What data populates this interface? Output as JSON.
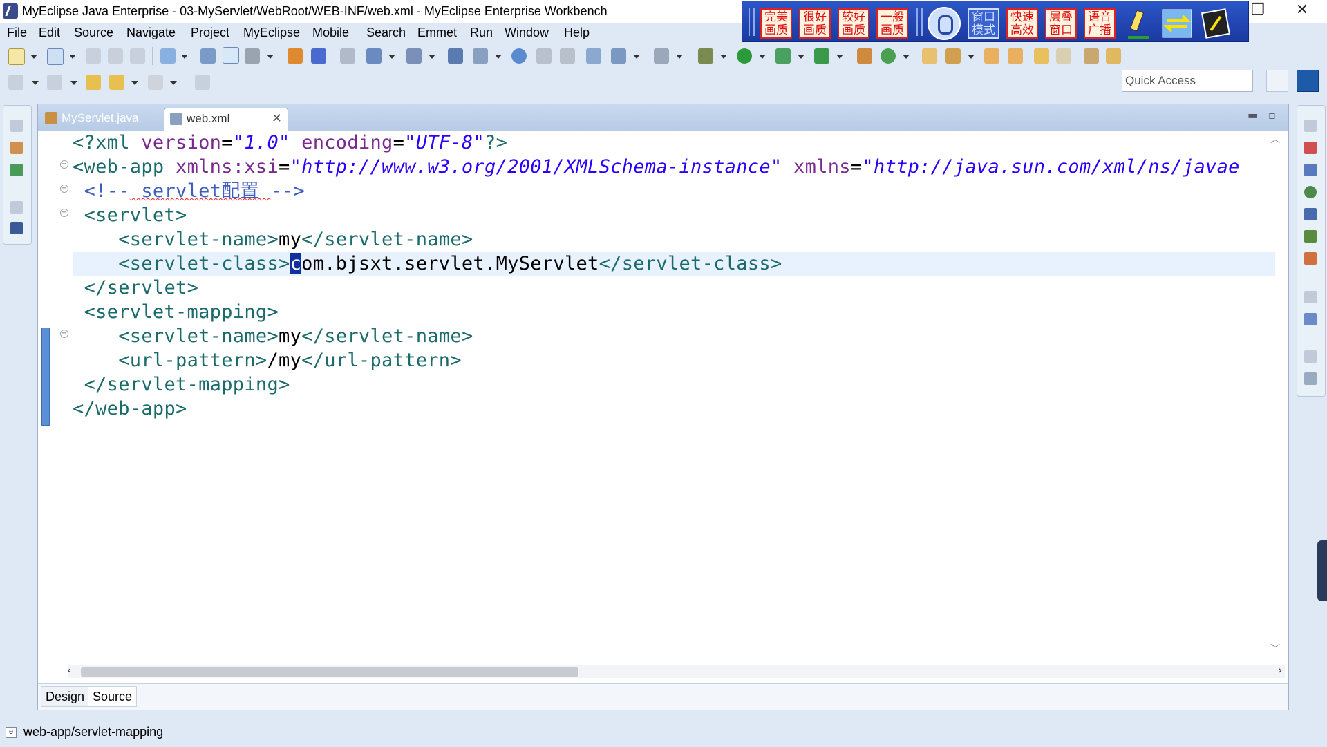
{
  "window": {
    "title": "MyEclipse Java Enterprise - 03-MyServlet/WebRoot/WEB-INF/web.xml - MyEclipse Enterprise Workbench",
    "restore_glyph": "❐",
    "close_glyph": "✕"
  },
  "recorder_toolbar": {
    "buttons": [
      "完美\n画质",
      "很好\n画质",
      "较好\n画质",
      "一般\n画质",
      "窗口\n模式",
      "快速\n高效",
      "层叠\n窗口",
      "语音\n广播"
    ]
  },
  "menu": [
    "File",
    "Edit",
    "Source",
    "Navigate",
    "Project",
    "MyEclipse",
    "Mobile",
    "Search",
    "Emmet",
    "Run",
    "Window",
    "Help"
  ],
  "quick_access": {
    "placeholder": "Quick Access"
  },
  "editor": {
    "tabs": [
      {
        "label": "MyServlet.java",
        "active": false
      },
      {
        "label": "web.xml",
        "active": true
      }
    ],
    "close_glyph": "✕",
    "minimize_glyph": "▬",
    "maximize_glyph": "▫",
    "lines": [
      "<?xml version=\"1.0\" encoding=\"UTF-8\"?>",
      "<web-app xmlns:xsi=\"http://www.w3.org/2001/XMLSchema-instance\" xmlns=\"http://java.sun.com/xml/ns/javae",
      " <!-- servlet配置 -->",
      " <servlet>",
      "    <servlet-name>my</servlet-name>",
      "    <servlet-class>com.bjsxt.servlet.MyServlet</servlet-class>",
      " </servlet>",
      " <servlet-mapping>",
      "    <servlet-name>my</servlet-name>",
      "    <url-pattern>/my</url-pattern>",
      " </servlet-mapping>",
      "</web-app>"
    ],
    "bottom_tabs": [
      {
        "label": "Design",
        "active": false
      },
      {
        "label": "Source",
        "active": true
      }
    ]
  },
  "status": {
    "path": "web-app/servlet-mapping",
    "icon_letter": "e"
  },
  "colors": {
    "tag": "#1b6b6b",
    "attribute": "#7a2a8f",
    "string": "#2a00ff",
    "comment": "#3f5fbf",
    "caret": "#1030a0",
    "current_line": "#e8f2fe"
  }
}
